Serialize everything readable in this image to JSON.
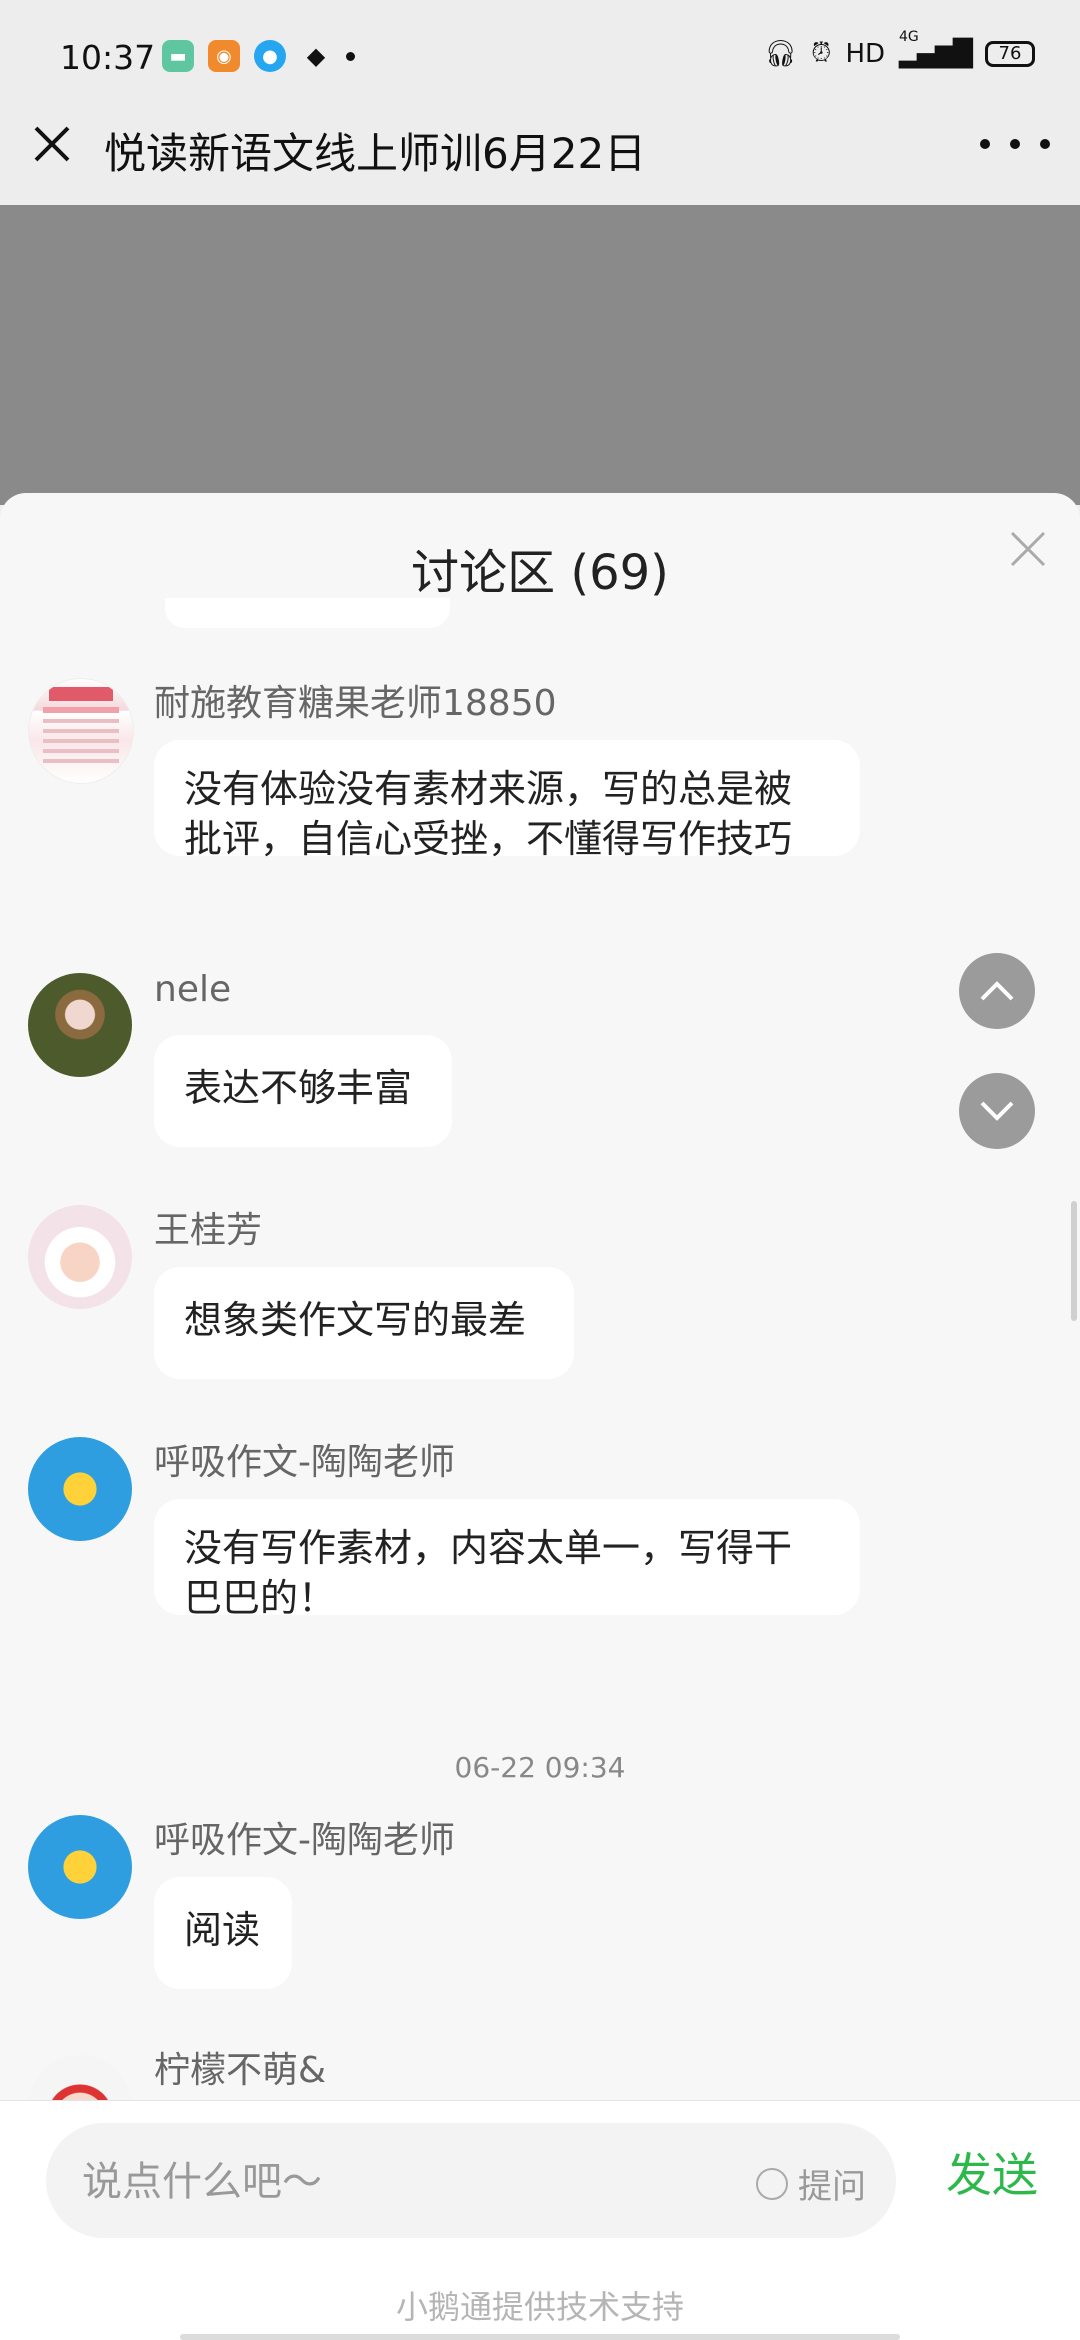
{
  "status_bar": {
    "time": "10:37",
    "network": "HD",
    "signal_label": "4G",
    "battery": "76",
    "left_icons": [
      "message-app-icon",
      "uc-browser-icon",
      "qq-icon",
      "layers-icon"
    ],
    "right_icons": [
      "headphones-icon",
      "alarm-icon",
      "signal-icon",
      "battery-icon"
    ]
  },
  "title_bar": {
    "title": "悦读新语文线上师训6月22日"
  },
  "discussion": {
    "header": "讨论区 (69)",
    "timestamp": "06-22 09:34",
    "messages": [
      {
        "name": "耐施教育糖果老师18850",
        "text_line1": "没有体验没有素材来源，写的总是被",
        "text_line2": "批评，自信心受挫，不懂得写作技巧"
      },
      {
        "name": "nele",
        "text": "表达不够丰富"
      },
      {
        "name": "王桂芳",
        "text": "想象类作文写的最差"
      },
      {
        "name": "呼吸作文-陶陶老师",
        "text_line1": "没有写作素材，内容太单一，写得干",
        "text_line2": "巴巴的！"
      },
      {
        "name": "呼吸作文-陶陶老师",
        "text": "阅读"
      },
      {
        "name": "柠檬不萌&"
      }
    ]
  },
  "input": {
    "placeholder": "说点什么吧～",
    "ask_label": "提问",
    "send_label": "发送"
  },
  "footer": {
    "text": "小鹅通提供技术支持"
  },
  "colors": {
    "send": "#2db84b",
    "overlay": "#8a8a8a"
  }
}
